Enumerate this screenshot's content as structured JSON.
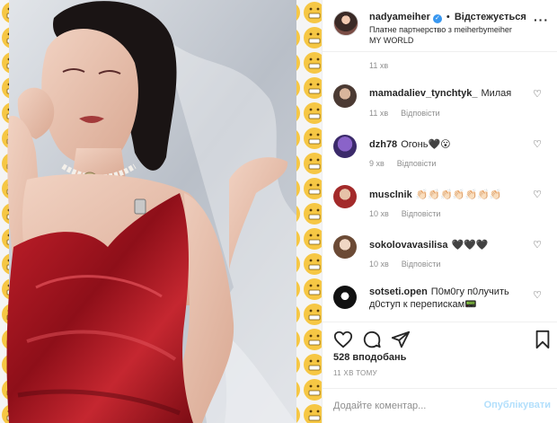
{
  "post": {
    "image_alt": "",
    "author": {
      "username": "nadyameiher",
      "verified": true,
      "follow_label": "Відстежується",
      "partnership": "Платне партнерство з meiherbymeiher",
      "location": "MY WORLD"
    }
  },
  "comments": {
    "first_time": "11 хв",
    "items": [
      {
        "username": "mamadaliev_tynchtyk_",
        "text": "Милая",
        "time": "11 хв",
        "reply": "Відповісти"
      },
      {
        "username": "dzh78",
        "text": "Огонь🖤😮",
        "time": "9 хв",
        "reply": "Відповісти"
      },
      {
        "username": "musclnik",
        "text": "👏🏻👏🏻👏🏻👏🏻👏🏻👏🏻👏🏻",
        "time": "10 хв",
        "reply": "Відповісти"
      },
      {
        "username": "sokolovavasilisa",
        "text": "🖤🖤🖤",
        "time": "10 хв",
        "reply": "Відповісти"
      },
      {
        "username": "sotseti.open",
        "text": "П0м0гу п0лучить д0ступ к перепискам📟",
        "time": "9 хв",
        "reply": "Відповісти"
      }
    ]
  },
  "footer": {
    "likes": "528 вподобань",
    "posted_time": "11 ХВ ТОМУ",
    "comment_placeholder": "Додайте коментар...",
    "publish_label": "Опублікувати"
  },
  "icons": {
    "like": "heart-icon",
    "comment": "comment-icon",
    "share": "send-icon",
    "save": "bookmark-icon",
    "more": "more-options-icon",
    "verified": "verified-badge-icon",
    "comment_like": "heart-outline-icon"
  },
  "colors": {
    "dress": "#a3121e",
    "background_wall": "#c9ced6",
    "emoji_border": "#f6c744",
    "link_disabled": "#b2dffc",
    "verified": "#3897f0"
  }
}
